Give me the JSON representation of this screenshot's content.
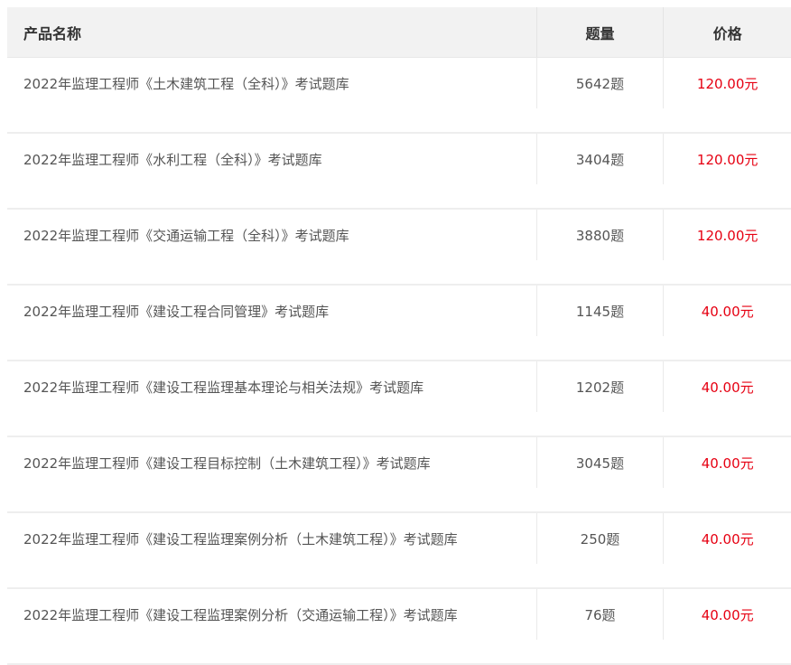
{
  "table": {
    "headers": {
      "name": "产品名称",
      "quantity": "题量",
      "price": "价格"
    },
    "rows": [
      {
        "name": "2022年监理工程师《土木建筑工程（全科）》考试题库",
        "quantity": "5642题",
        "price": "120.00元"
      },
      {
        "name": "2022年监理工程师《水利工程（全科）》考试题库",
        "quantity": "3404题",
        "price": "120.00元"
      },
      {
        "name": "2022年监理工程师《交通运输工程（全科）》考试题库",
        "quantity": "3880题",
        "price": "120.00元"
      },
      {
        "name": "2022年监理工程师《建设工程合同管理》考试题库",
        "quantity": "1145题",
        "price": "40.00元"
      },
      {
        "name": "2022年监理工程师《建设工程监理基本理论与相关法规》考试题库",
        "quantity": "1202题",
        "price": "40.00元"
      },
      {
        "name": "2022年监理工程师《建设工程目标控制（土木建筑工程）》考试题库",
        "quantity": "3045题",
        "price": "40.00元"
      },
      {
        "name": "2022年监理工程师《建设工程监理案例分析（土木建筑工程）》考试题库",
        "quantity": "250题",
        "price": "40.00元"
      },
      {
        "name": "2022年监理工程师《建设工程监理案例分析（交通运输工程）》考试题库",
        "quantity": "76题",
        "price": "40.00元"
      }
    ]
  },
  "colors": {
    "price": "#e60012",
    "header_bg": "#f2f2f2",
    "text": "#555555"
  }
}
